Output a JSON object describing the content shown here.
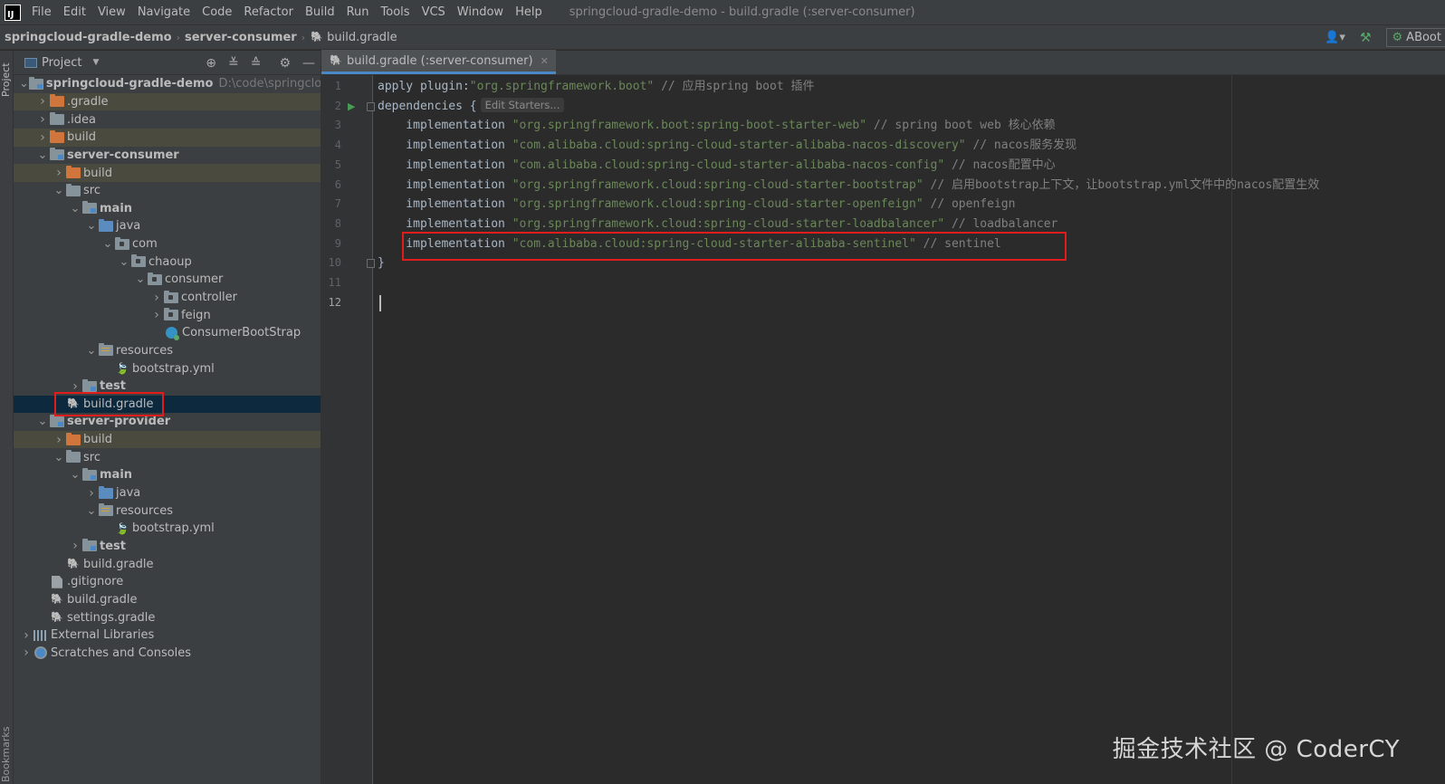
{
  "menubar": {
    "items": [
      "File",
      "Edit",
      "View",
      "Navigate",
      "Code",
      "Refactor",
      "Build",
      "Run",
      "Tools",
      "VCS",
      "Window",
      "Help"
    ],
    "window_title": "springcloud-gradle-demo - build.gradle (:server-consumer)"
  },
  "navbar": {
    "crumbs": [
      "springcloud-gradle-demo",
      "server-consumer"
    ],
    "file": "build.gradle",
    "run_config": "ABoot"
  },
  "toolstrip": {
    "project_label": "Project",
    "bookmarks_label": "Bookmarks"
  },
  "project_panel": {
    "title": "Project",
    "tree": [
      {
        "label": "springcloud-gradle-demo",
        "hint": "D:\\code\\springcloud-gr",
        "icon": "module-folder",
        "state": "expanded",
        "bold": true
      },
      {
        "label": ".gradle",
        "icon": "orange-folder",
        "state": "collapsed",
        "excluded": true
      },
      {
        "label": ".idea",
        "icon": "folder",
        "state": "collapsed"
      },
      {
        "label": "build",
        "icon": "orange-folder",
        "state": "collapsed",
        "excluded": true
      },
      {
        "label": "server-consumer",
        "icon": "module-folder",
        "state": "expanded",
        "bold": true
      },
      {
        "label": "build",
        "icon": "orange-folder",
        "state": "collapsed",
        "excluded": true
      },
      {
        "label": "src",
        "icon": "folder",
        "state": "expanded"
      },
      {
        "label": "main",
        "icon": "module-folder",
        "state": "expanded",
        "bold": true
      },
      {
        "label": "java",
        "icon": "blue-folder",
        "state": "expanded"
      },
      {
        "label": "com",
        "icon": "package-folder",
        "state": "expanded"
      },
      {
        "label": "chaoup",
        "icon": "package-folder",
        "state": "expanded"
      },
      {
        "label": "consumer",
        "icon": "package-folder",
        "state": "expanded"
      },
      {
        "label": "controller",
        "icon": "package-folder",
        "state": "collapsed"
      },
      {
        "label": "feign",
        "icon": "package-folder",
        "state": "collapsed"
      },
      {
        "label": "ConsumerBootStrap",
        "icon": "spring-class",
        "state": "leaf"
      },
      {
        "label": "resources",
        "icon": "resources-folder",
        "state": "expanded"
      },
      {
        "label": "bootstrap.yml",
        "icon": "yml-file",
        "state": "leaf"
      },
      {
        "label": "test",
        "icon": "module-folder",
        "state": "collapsed",
        "bold": true
      },
      {
        "label": "build.gradle",
        "icon": "gradle-file",
        "state": "leaf",
        "selected": true
      },
      {
        "label": "server-provider",
        "icon": "module-folder",
        "state": "expanded",
        "bold": true
      },
      {
        "label": "build",
        "icon": "orange-folder",
        "state": "collapsed",
        "excluded": true
      },
      {
        "label": "src",
        "icon": "folder",
        "state": "expanded"
      },
      {
        "label": "main",
        "icon": "module-folder",
        "state": "expanded",
        "bold": true
      },
      {
        "label": "java",
        "icon": "blue-folder",
        "state": "collapsed"
      },
      {
        "label": "resources",
        "icon": "resources-folder",
        "state": "expanded"
      },
      {
        "label": "bootstrap.yml",
        "icon": "yml-file",
        "state": "leaf"
      },
      {
        "label": "test",
        "icon": "module-folder",
        "state": "collapsed",
        "bold": true
      },
      {
        "label": "build.gradle",
        "icon": "gradle-file",
        "state": "leaf"
      },
      {
        "label": ".gitignore",
        "icon": "gitignore-file",
        "state": "leaf"
      },
      {
        "label": "build.gradle",
        "icon": "gradle-file",
        "state": "leaf"
      },
      {
        "label": "settings.gradle",
        "icon": "gradle-file",
        "state": "leaf"
      },
      {
        "label": "External Libraries",
        "icon": "library",
        "state": "collapsed"
      },
      {
        "label": "Scratches and Consoles",
        "icon": "scratches",
        "state": "collapsed"
      }
    ]
  },
  "editor": {
    "tab_label": "build.gradle (:server-consumer)",
    "inlay_hint": "Edit Starters...",
    "current_line": 12,
    "lines": [
      {
        "n": "1",
        "parts": [
          [
            "kw",
            "apply plugin:"
          ],
          [
            "str",
            "\"org.springframework.boot\""
          ],
          [
            "cmt",
            " // 应用spring boot 插件"
          ]
        ]
      },
      {
        "n": "2",
        "parts": [
          [
            "kw",
            "dependencies {"
          ]
        ],
        "inlay": true
      },
      {
        "n": "3",
        "parts": [
          [
            "kw",
            "    implementation "
          ],
          [
            "str",
            "\"org.springframework.boot:spring-boot-starter-web\""
          ],
          [
            "cmt",
            " // spring boot web 核心依赖"
          ]
        ]
      },
      {
        "n": "4",
        "parts": [
          [
            "kw",
            "    implementation "
          ],
          [
            "str",
            "\"com.alibaba.cloud:spring-cloud-starter-alibaba-nacos-discovery\""
          ],
          [
            "cmt",
            " // nacos服务发现"
          ]
        ]
      },
      {
        "n": "5",
        "parts": [
          [
            "kw",
            "    implementation "
          ],
          [
            "str",
            "\"com.alibaba.cloud:spring-cloud-starter-alibaba-nacos-config\""
          ],
          [
            "cmt",
            " // nacos配置中心"
          ]
        ]
      },
      {
        "n": "6",
        "parts": [
          [
            "kw",
            "    implementation "
          ],
          [
            "str",
            "\"org.springframework.cloud:spring-cloud-starter-bootstrap\""
          ],
          [
            "cmt",
            " // 启用bootstrap上下文，让bootstrap.yml文件中的nacos配置生效"
          ]
        ]
      },
      {
        "n": "7",
        "parts": [
          [
            "kw",
            "    implementation "
          ],
          [
            "str",
            "\"org.springframework.cloud:spring-cloud-starter-openfeign\""
          ],
          [
            "cmt",
            " // openfeign"
          ]
        ]
      },
      {
        "n": "8",
        "parts": [
          [
            "kw",
            "    implementation "
          ],
          [
            "str",
            "\"org.springframework.cloud:spring-cloud-starter-loadbalancer\""
          ],
          [
            "cmt",
            " // loadbalancer"
          ]
        ]
      },
      {
        "n": "9",
        "parts": [
          [
            "kw",
            "    implementation "
          ],
          [
            "str",
            "\"com.alibaba.cloud:spring-cloud-starter-alibaba-sentinel\""
          ],
          [
            "cmt",
            " // sentinel"
          ]
        ]
      },
      {
        "n": "10",
        "parts": [
          [
            "kw",
            "}"
          ]
        ]
      },
      {
        "n": "11",
        "parts": []
      },
      {
        "n": "12",
        "parts": []
      }
    ]
  },
  "watermark": "掘金技术社区 @ CoderCY",
  "colors": {
    "highlight_box": "#e01c1c",
    "selection": "#0d293e",
    "string": "#6a8759",
    "comment": "#808080"
  }
}
